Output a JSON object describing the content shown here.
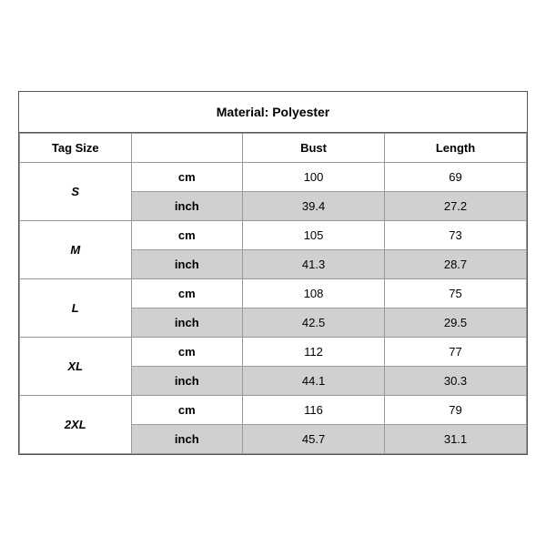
{
  "material": {
    "label": "Material: Polyester"
  },
  "table": {
    "columns": {
      "tag_size": "Tag Size",
      "bust": "Bust",
      "length": "Length"
    },
    "rows": [
      {
        "size": "S",
        "cm": {
          "unit": "cm",
          "bust": "100",
          "length": "69"
        },
        "inch": {
          "unit": "inch",
          "bust": "39.4",
          "length": "27.2"
        }
      },
      {
        "size": "M",
        "cm": {
          "unit": "cm",
          "bust": "105",
          "length": "73"
        },
        "inch": {
          "unit": "inch",
          "bust": "41.3",
          "length": "28.7"
        }
      },
      {
        "size": "L",
        "cm": {
          "unit": "cm",
          "bust": "108",
          "length": "75"
        },
        "inch": {
          "unit": "inch",
          "bust": "42.5",
          "length": "29.5"
        }
      },
      {
        "size": "XL",
        "cm": {
          "unit": "cm",
          "bust": "112",
          "length": "77"
        },
        "inch": {
          "unit": "inch",
          "bust": "44.1",
          "length": "30.3"
        }
      },
      {
        "size": "2XL",
        "cm": {
          "unit": "cm",
          "bust": "116",
          "length": "79"
        },
        "inch": {
          "unit": "inch",
          "bust": "45.7",
          "length": "31.1"
        }
      }
    ]
  }
}
